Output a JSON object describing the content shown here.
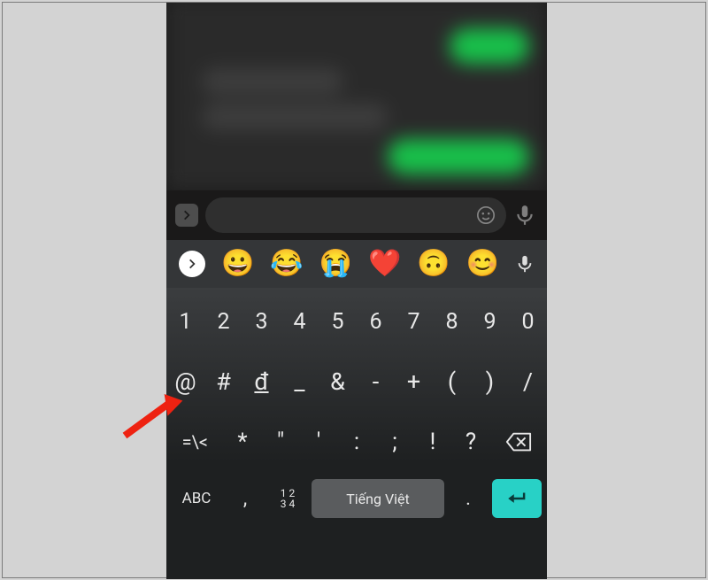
{
  "emoji_row": {
    "items": [
      "😀",
      "😂",
      "😭",
      "❤️",
      "🙃",
      "😊"
    ]
  },
  "keyboard": {
    "row1": [
      "1",
      "2",
      "3",
      "4",
      "5",
      "6",
      "7",
      "8",
      "9",
      "0"
    ],
    "row2": [
      "@",
      "#",
      "đ",
      "_",
      "&",
      "-",
      "+",
      "(",
      ")",
      "/"
    ],
    "row3": {
      "sym": "=\\<",
      "keys": [
        "*",
        "\"",
        "'",
        ":",
        ";",
        "!",
        "?"
      ]
    },
    "row4": {
      "abc": "ABC",
      "comma": ",",
      "numgrid_top": "1 2",
      "numgrid_bot": "3 4",
      "space": "Tiếng Việt",
      "dot": "."
    }
  }
}
